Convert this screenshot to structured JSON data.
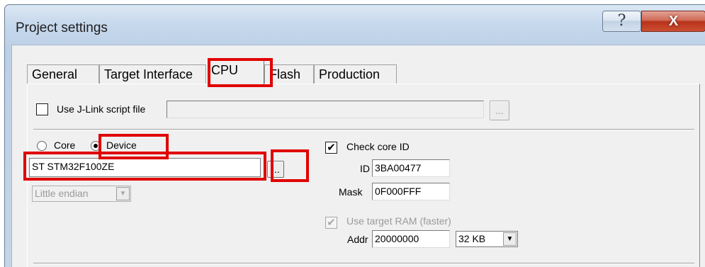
{
  "window": {
    "title": "Project settings",
    "help_glyph": "?",
    "close_glyph": "X"
  },
  "tabs": [
    {
      "label": "General"
    },
    {
      "label": "Target Interface"
    },
    {
      "label": "CPU"
    },
    {
      "label": "Flash"
    },
    {
      "label": "Production"
    }
  ],
  "active_tab": "CPU",
  "script": {
    "checkbox_label": "Use J-Link script file",
    "checked": false,
    "path_value": "",
    "browse_label": "..."
  },
  "target": {
    "core_label": "Core",
    "device_label": "Device",
    "selected": "Device",
    "device_value": "ST STM32F100ZE",
    "device_browse_label": "...",
    "endian_value": "Little endian"
  },
  "core_id": {
    "check_label": "Check core ID",
    "checked": true,
    "id_label": "ID",
    "id_value": "3BA00477",
    "mask_label": "Mask",
    "mask_value": "0F000FFF"
  },
  "ram": {
    "check_label": "Use target RAM (faster)",
    "checked": true,
    "enabled": false,
    "addr_label": "Addr",
    "addr_value": "20000000",
    "size_value": "32 KB"
  },
  "icons": {
    "help": "question-mark-icon",
    "close": "close-x-icon",
    "dropdown": "chevron-down-icon",
    "check": "checkmark-icon"
  },
  "highlight_color": "#e00000"
}
